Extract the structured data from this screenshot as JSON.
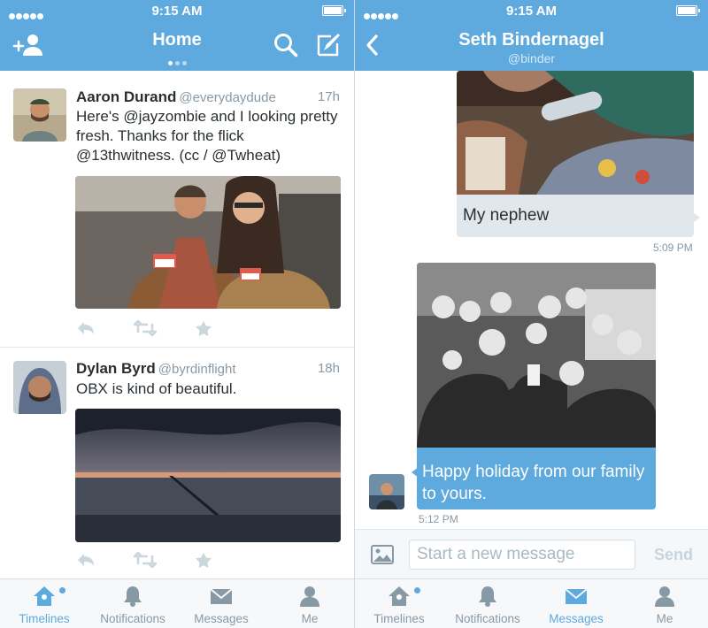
{
  "status": {
    "time": "9:15 AM"
  },
  "colors": {
    "brand": "#5ea9dd",
    "muted": "#8899a6",
    "text": "#292f33"
  },
  "home": {
    "title": "Home",
    "tweets": [
      {
        "name": "Aaron Durand",
        "handle": "@everydaydude",
        "age": "17h",
        "text": "Here's @jayzombie and I looking pretty fresh. Thanks for the flick @13thwitness.  (cc / @Twheat)",
        "media_desc": "photo-couple-name-tags"
      },
      {
        "name": "Dylan Byrd",
        "handle": "@byrdinflight",
        "age": "18h",
        "text": "OBX is kind of beautiful.",
        "media_desc": "photo-sunset-pier"
      }
    ]
  },
  "dm": {
    "name": "Seth Bindernagel",
    "handle": "@binder",
    "messages": [
      {
        "direction": "in",
        "text": "My nephew",
        "time": "5:09 PM"
      },
      {
        "direction": "out",
        "text": "Happy holiday from our family to yours.",
        "time": "5:12 PM"
      }
    ],
    "composer": {
      "placeholder": "Start a new message",
      "send_label": "Send"
    }
  },
  "tabs": [
    {
      "label": "Timelines",
      "icon": "home-icon"
    },
    {
      "label": "Notifications",
      "icon": "bell-icon"
    },
    {
      "label": "Messages",
      "icon": "envelope-icon"
    },
    {
      "label": "Me",
      "icon": "person-icon"
    }
  ]
}
